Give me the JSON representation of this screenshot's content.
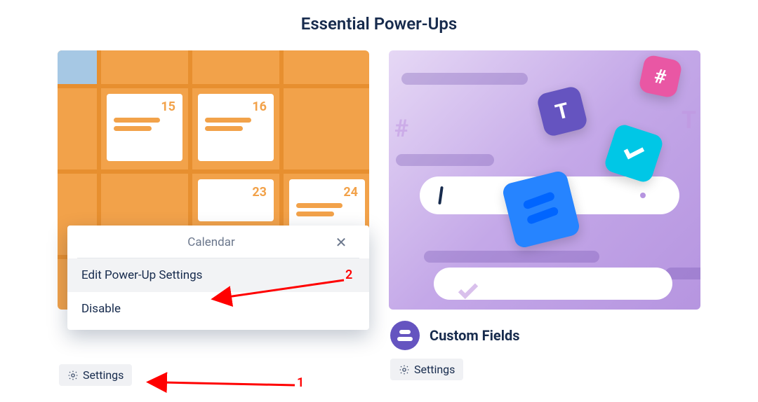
{
  "header": {
    "title": "Essential Power-Ups"
  },
  "cards": {
    "calendar": {
      "days": {
        "d15": "15",
        "d16": "16",
        "d23": "23",
        "d24": "24"
      },
      "settings_label": "Settings"
    },
    "custom_fields": {
      "title": "Custom Fields",
      "settings_label": "Settings"
    }
  },
  "popup": {
    "title": "Calendar",
    "items": {
      "edit": "Edit Power-Up Settings",
      "disable": "Disable"
    }
  },
  "annotations": {
    "n1": "1",
    "n2": "2"
  }
}
